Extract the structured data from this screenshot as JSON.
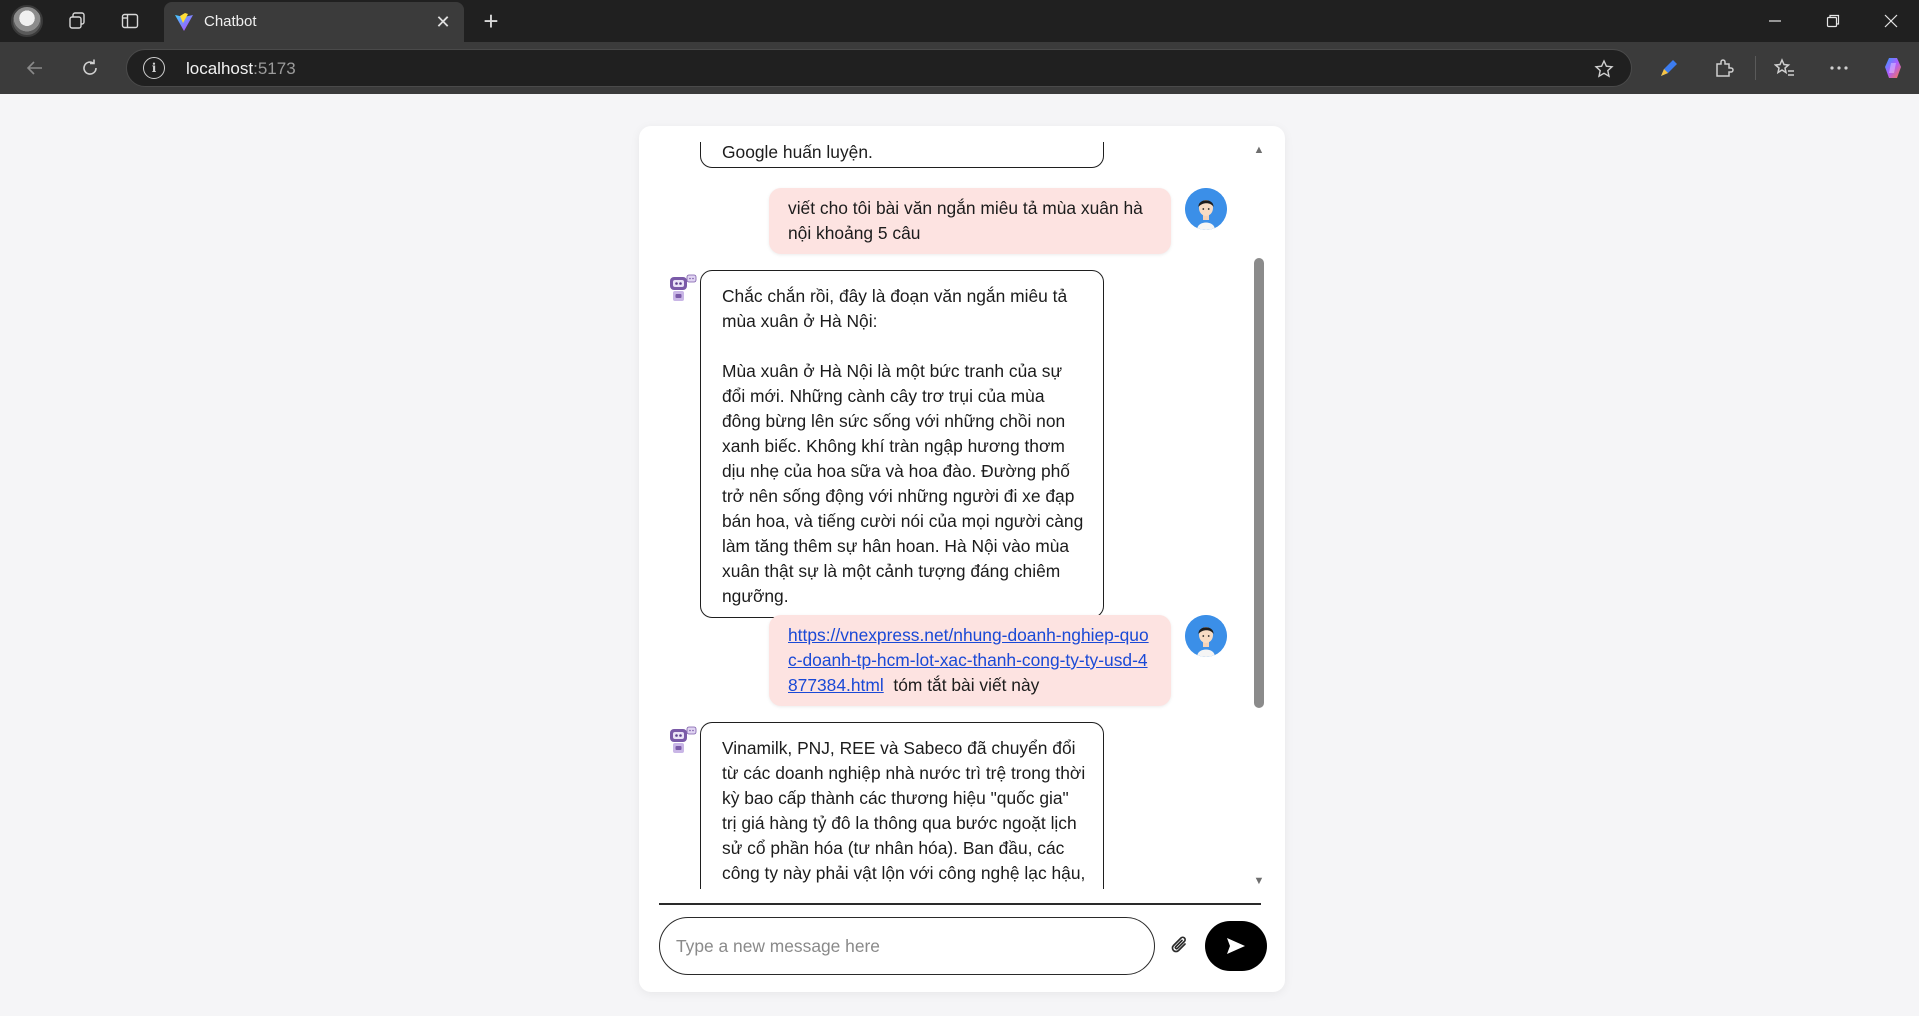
{
  "browser": {
    "tab_title": "Chatbot",
    "url_host": "localhost",
    "url_port": ":5173"
  },
  "chat": {
    "messages": [
      {
        "role": "bot",
        "text": "Google huấn luyện."
      },
      {
        "role": "user",
        "text": "viết cho tôi bài văn ngắn miêu tả mùa xuân hà nội khoảng 5 câu"
      },
      {
        "role": "bot",
        "text": "Chắc chắn rồi, đây là đoạn văn ngắn miêu tả mùa xuân ở Hà Nội:\n\nMùa xuân ở Hà Nội là một bức tranh của sự đổi mới. Những cành cây trơ trụi của mùa đông bừng lên sức sống với những chồi non xanh biếc. Không khí tràn ngập hương thơm dịu nhẹ của hoa sữa và hoa đào. Đường phố trở nên sống động với những người đi xe đạp bán hoa, và tiếng cười nói của mọi người càng làm tăng thêm sự hân hoan. Hà Nội vào mùa xuân thật sự là một cảnh tượng đáng chiêm ngưỡng."
      },
      {
        "role": "user",
        "link": "https://vnexpress.net/nhung-doanh-nghiep-quoc-doanh-tp-hcm-lot-xac-thanh-cong-ty-ty-usd-4877384.html",
        "text": "tóm tắt bài viết này"
      },
      {
        "role": "bot",
        "text": "Vinamilk, PNJ, REE và Sabeco đã chuyển đổi từ các doanh nghiệp nhà nước trì trệ trong thời kỳ bao cấp thành các thương hiệu \"quốc gia\" trị giá hàng tỷ đô la thông qua bước ngoặt lịch sử cổ phần hóa (tư nhân hóa). Ban đầu, các công ty này phải vật lộn với công nghệ lạc hậu, khan hiếm nguồn lực và bộ máy quan liêu"
      }
    ],
    "input_placeholder": "Type a new message here"
  },
  "colors": {
    "user_bubble": "#fde3e1",
    "link": "#1a49d6",
    "send_button": "#000000",
    "user_avatar_bg": "#3b8fe8"
  }
}
